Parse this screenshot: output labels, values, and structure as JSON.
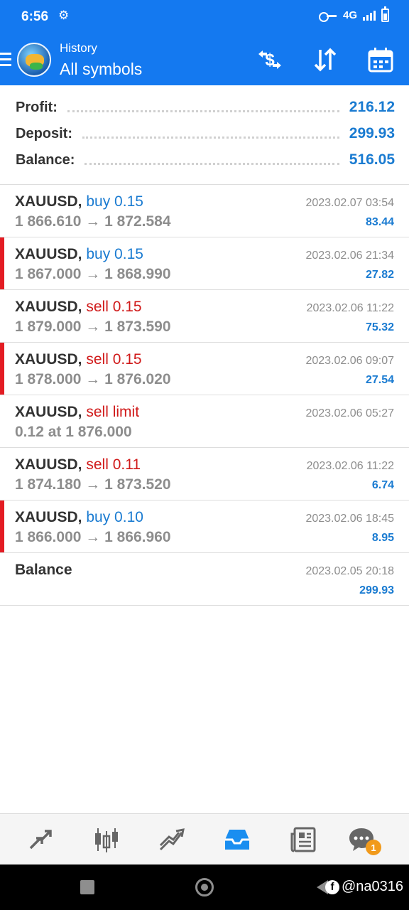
{
  "status_bar": {
    "time": "6:56",
    "network": "4G",
    "icons": [
      "settings-icon",
      "key-icon",
      "signal-icon",
      "battery-icon"
    ]
  },
  "app_bar": {
    "subtitle": "History",
    "title": "All symbols",
    "actions": [
      "deposit-withdraw-icon",
      "sort-icon",
      "calendar-icon"
    ],
    "color": "#1479f0"
  },
  "summary": {
    "profit_label": "Profit:",
    "profit_value": "216.12",
    "deposit_label": "Deposit:",
    "deposit_value": "299.93",
    "balance_label": "Balance:",
    "balance_value": "516.05"
  },
  "deals": [
    {
      "symbol": "XAUUSD,",
      "type": "buy 0.15",
      "direction": "buy",
      "prices": "1 866.610 → 1 872.584",
      "time": "2023.02.07 03:54",
      "profit": "83.44",
      "marked": false
    },
    {
      "symbol": "XAUUSD,",
      "type": "buy 0.15",
      "direction": "buy",
      "prices": "1 867.000 → 1 868.990",
      "time": "2023.02.06 21:34",
      "profit": "27.82",
      "marked": true
    },
    {
      "symbol": "XAUUSD,",
      "type": "sell 0.15",
      "direction": "sell",
      "prices": "1 879.000 → 1 873.590",
      "time": "2023.02.06 11:22",
      "profit": "75.32",
      "marked": false
    },
    {
      "symbol": "XAUUSD,",
      "type": "sell 0.15",
      "direction": "sell",
      "prices": "1 878.000 → 1 876.020",
      "time": "2023.02.06 09:07",
      "profit": "27.54",
      "marked": true
    },
    {
      "symbol": "XAUUSD,",
      "type": "sell limit",
      "direction": "sell",
      "prices": "0.12 at 1 876.000",
      "time": "2023.02.06 05:27",
      "profit": "",
      "marked": false
    },
    {
      "symbol": "XAUUSD,",
      "type": "sell 0.11",
      "direction": "sell",
      "prices": "1 874.180 → 1 873.520",
      "time": "2023.02.06 11:22",
      "profit": "6.74",
      "marked": false
    },
    {
      "symbol": "XAUUSD,",
      "type": "buy 0.10",
      "direction": "buy",
      "prices": "1 866.000 → 1 866.960",
      "time": "2023.02.06 18:45",
      "profit": "8.95",
      "marked": true
    },
    {
      "symbol": "Balance",
      "type": "",
      "direction": "none",
      "prices": "",
      "time": "2023.02.05 20:18",
      "profit": "299.93",
      "marked": false
    }
  ],
  "bottom_nav": {
    "items": [
      "quotes-icon",
      "chart-icon",
      "trade-icon",
      "history-icon",
      "news-icon",
      "messages-icon"
    ],
    "active": "history-icon",
    "messages_badge": "1"
  },
  "watermark": {
    "text": "@na0316"
  },
  "colors": {
    "accent": "#1479f0",
    "profit_blue": "#1a7bd1",
    "sell_red": "#d01a1a",
    "marker_red": "#e31c23",
    "badge_orange": "#f19a1b"
  }
}
